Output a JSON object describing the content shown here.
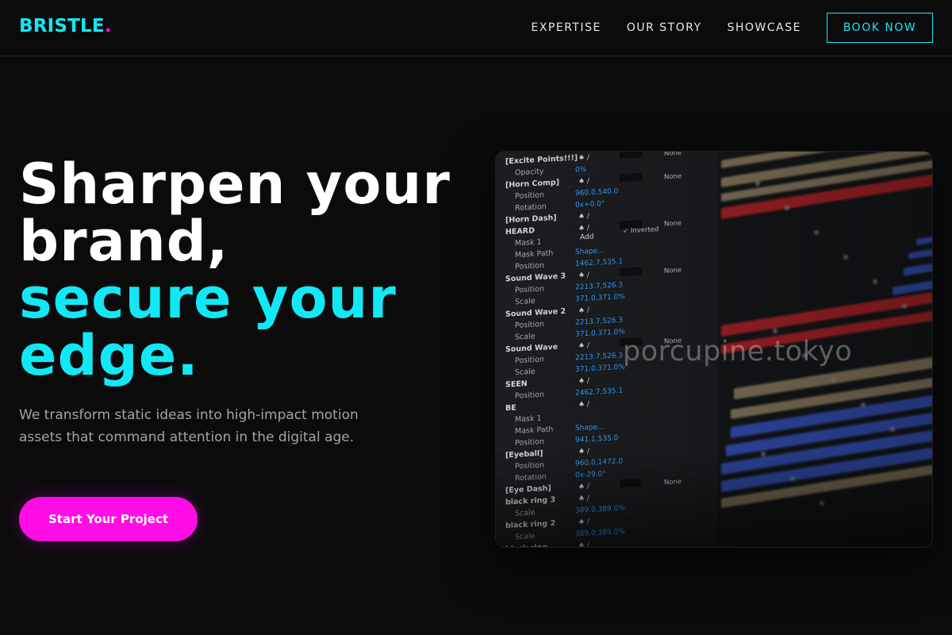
{
  "brand": {
    "name": "BRISTLE",
    "dot": "."
  },
  "nav": {
    "links": [
      "EXPERTISE",
      "OUR STORY",
      "SHOWCASE"
    ],
    "cta_label": "BOOK NOW"
  },
  "hero": {
    "title_lines_white": [
      "Sharpen your",
      "brand,"
    ],
    "title_lines_accent": [
      "secure your",
      "edge."
    ],
    "subtitle": "We transform static ideas into high-impact motion assets that command attention in the digital age.",
    "cta_label": "Start Your Project",
    "image": {
      "watermark": "porcupine.tokyo",
      "layer_names": [
        "[Excite Points!!!]",
        "Opacity",
        "[Horn Comp]",
        "Position",
        "Rotation",
        "[Horn Dash]",
        "HEARD",
        "Mask 1",
        "Mask Path",
        "Position",
        "Sound Wave 3",
        "Position",
        "Scale",
        "Sound Wave 2",
        "Position",
        "Scale",
        "Sound Wave",
        "Position",
        "Scale",
        "SEEN",
        "Position",
        "BE",
        "Mask 1",
        "Mask Path",
        "Position",
        "[Eyeball]",
        "Position",
        "Rotation",
        "[Eye Dash]",
        "black ring 3",
        "Scale",
        "black ring 2",
        "Scale",
        "black ring"
      ],
      "layer_values": [
        "",
        "0%",
        "",
        "960.0,540.0",
        "0x+0.0°",
        "",
        "",
        "",
        "Shape...",
        "1462.7,535.1",
        "",
        "2213.7,526.3",
        "371.0,371.0%",
        "",
        "2213.7,526.3",
        "371.0,371.0%",
        "",
        "2213.7,526.3",
        "371.0,371.0%",
        "",
        "2462.7,535.1",
        "",
        "",
        "Shape...",
        "941.1,535.0",
        "",
        "960.0,1472.0",
        "0x-29.0°",
        "",
        "",
        "389.0,389.0%",
        "",
        "389.0,389.0%",
        ""
      ],
      "mode_label": "None",
      "add_label": "Add",
      "inverted_label": "Inverted"
    }
  },
  "colors": {
    "accent": "#12e8f5",
    "magenta": "#ff0de6",
    "background": "#0b0b0c",
    "track_tan": "#9a8a6a",
    "track_red": "#c4272c",
    "track_blue": "#3b5bd0"
  }
}
